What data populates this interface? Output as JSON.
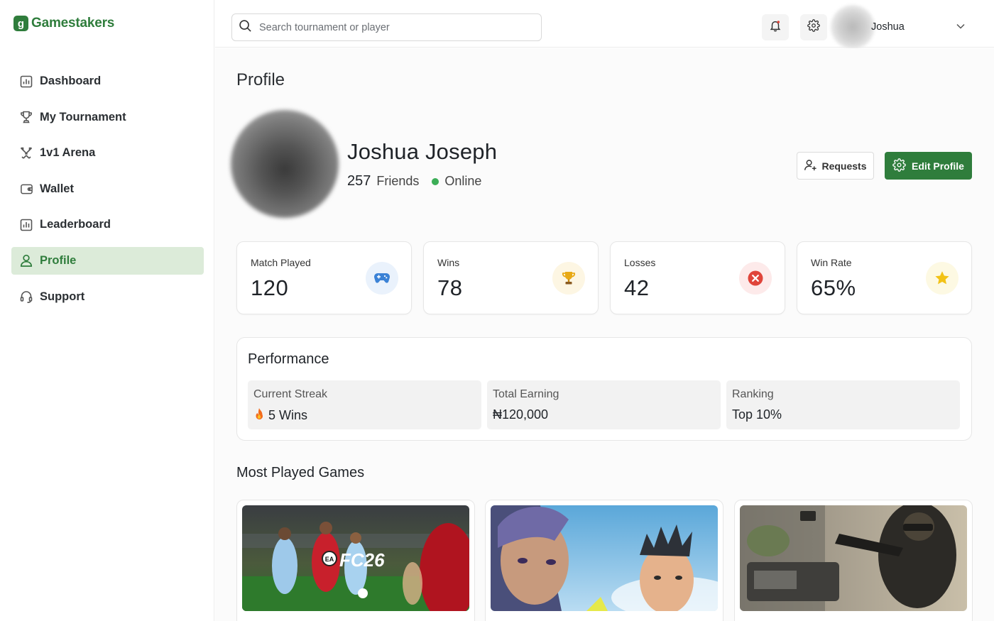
{
  "brand": {
    "name": "Gamestakers",
    "mark": "g",
    "color": "#2f7d3c"
  },
  "sidebar": {
    "items": [
      {
        "label": "Dashboard",
        "icon": "chart-icon",
        "active": false
      },
      {
        "label": "My Tournament",
        "icon": "trophy-icon",
        "active": false
      },
      {
        "label": "1v1 Arena",
        "icon": "swords-icon",
        "active": false
      },
      {
        "label": "Wallet",
        "icon": "wallet-icon",
        "active": false
      },
      {
        "label": "Leaderboard",
        "icon": "leaderboard-icon",
        "active": false
      },
      {
        "label": "Profile",
        "icon": "user-icon",
        "active": true
      },
      {
        "label": "Support",
        "icon": "headset-icon",
        "active": false
      }
    ]
  },
  "header": {
    "search_placeholder": "Search tournament or player",
    "user_name": "Joshua"
  },
  "page": {
    "title": "Profile"
  },
  "profile": {
    "name": "Joshua Joseph",
    "friends_count": "257",
    "friends_label": "Friends",
    "status": "Online",
    "requests_label": "Requests",
    "edit_label": "Edit Profile"
  },
  "stats": [
    {
      "label": "Match Played",
      "value": "120",
      "icon": "gamepad-icon",
      "icon_bg": "#eaf2fc",
      "icon_color": "#3b82d6"
    },
    {
      "label": "Wins",
      "value": "78",
      "icon": "trophy-icon",
      "icon_bg": "#fdf6e3",
      "icon_color": "#d4a017"
    },
    {
      "label": "Losses",
      "value": "42",
      "icon": "x-circle-icon",
      "icon_bg": "#fdeaea",
      "icon_color": "#e0443a"
    },
    {
      "label": "Win Rate",
      "value": "65%",
      "icon": "star-icon",
      "icon_bg": "#fdf9e3",
      "icon_color": "#f2c216"
    }
  ],
  "performance": {
    "title": "Performance",
    "items": [
      {
        "label": "Current Streak",
        "value": "5 Wins",
        "icon": "fire-icon"
      },
      {
        "label": "Total Earning",
        "value": "₦120,000"
      },
      {
        "label": "Ranking",
        "value": "Top 10%"
      }
    ]
  },
  "most_played": {
    "title": "Most Played Games",
    "games": [
      {
        "title_art": "FC26",
        "publisher_badge": "EA"
      },
      {
        "title_art": ""
      },
      {
        "title_art": ""
      }
    ]
  }
}
